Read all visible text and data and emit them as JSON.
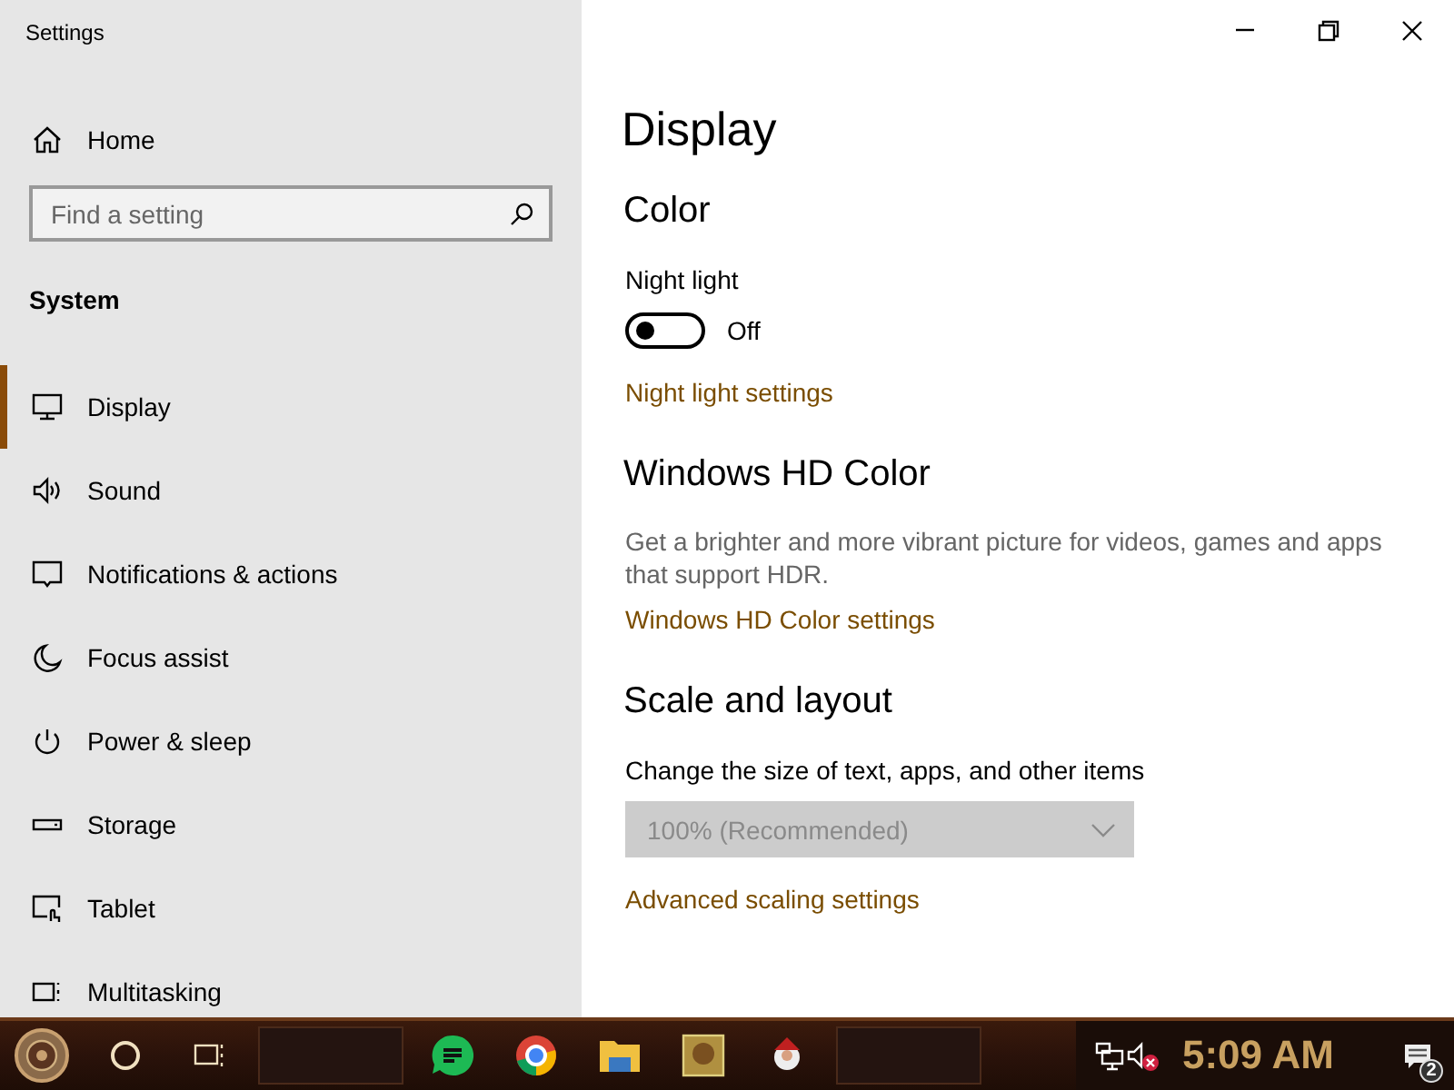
{
  "window": {
    "title": "Settings"
  },
  "sidebar": {
    "home": {
      "label": "Home"
    },
    "search": {
      "placeholder": "Find a setting"
    },
    "section": "System",
    "items": [
      {
        "label": "Display",
        "kind": "monitor",
        "selected": true
      },
      {
        "label": "Sound",
        "kind": "speaker",
        "selected": false
      },
      {
        "label": "Notifications & actions",
        "kind": "message",
        "selected": false
      },
      {
        "label": "Focus assist",
        "kind": "moon",
        "selected": false
      },
      {
        "label": "Power & sleep",
        "kind": "power",
        "selected": false
      },
      {
        "label": "Storage",
        "kind": "drive",
        "selected": false
      },
      {
        "label": "Tablet",
        "kind": "tablet",
        "selected": false
      },
      {
        "label": "Multitasking",
        "kind": "tasks",
        "selected": false
      }
    ]
  },
  "page": {
    "title": "Display",
    "sections": [
      {
        "heading": "Color",
        "items": [
          {
            "kind": "label",
            "text": "Night light"
          },
          {
            "kind": "toggle",
            "on": false,
            "state_text": "Off"
          },
          {
            "kind": "link",
            "text": "Night light settings"
          }
        ]
      },
      {
        "heading": "Windows HD Color",
        "items": [
          {
            "kind": "text",
            "text": "Get a brighter and more vibrant picture for videos, games and apps that support HDR."
          },
          {
            "kind": "link",
            "text": "Windows HD Color settings"
          }
        ]
      },
      {
        "heading": "Scale and layout",
        "items": [
          {
            "kind": "label",
            "text": "Change the size of text, apps, and other items"
          },
          {
            "kind": "dropdown",
            "value": "100% (Recommended)",
            "disabled": true
          },
          {
            "kind": "link",
            "text": "Advanced scaling settings"
          }
        ]
      }
    ]
  },
  "taskbar": {
    "apps": [
      {
        "kind": "chat"
      },
      {
        "kind": "browser"
      },
      {
        "kind": "folder"
      },
      {
        "kind": "game"
      },
      {
        "kind": "santa"
      }
    ],
    "volume_muted": true,
    "clock": "5:09 AM",
    "notification_count": "2"
  }
}
